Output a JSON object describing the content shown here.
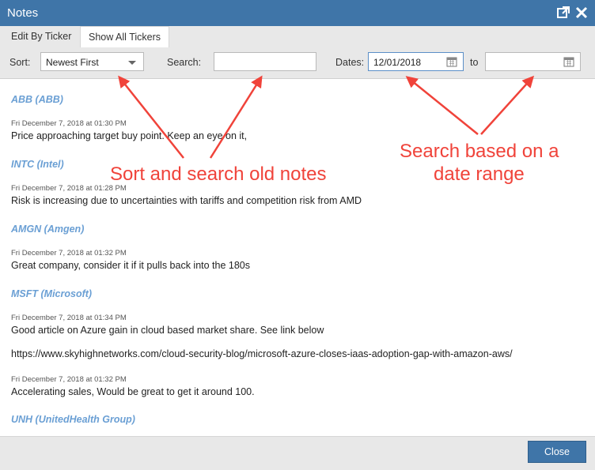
{
  "window": {
    "title": "Notes"
  },
  "tabs": [
    {
      "label": "Edit By Ticker"
    },
    {
      "label": "Show All Tickers"
    }
  ],
  "filters": {
    "sort_label": "Sort:",
    "sort_value": "Newest First",
    "search_label": "Search:",
    "search_value": "",
    "dates_label": "Dates:",
    "date_from": "12/01/2018",
    "to_label": "to",
    "date_to": ""
  },
  "notes": [
    {
      "ticker": "ABB (ABB)",
      "timestamp": "Fri December 7, 2018 at 01:30 PM",
      "text": "Price approaching target buy point. Keep an eye on it,"
    },
    {
      "ticker": "INTC (Intel)",
      "timestamp": "Fri December 7, 2018 at 01:28 PM",
      "text": "Risk is increasing due to uncertainties with tariffs and competition risk from AMD"
    },
    {
      "ticker": "AMGN (Amgen)",
      "timestamp": "Fri December 7, 2018 at 01:32 PM",
      "text": "Great company, consider it if it pulls back into the 180s"
    },
    {
      "ticker": "MSFT (Microsoft)",
      "timestamp": "Fri December 7, 2018 at 01:34 PM",
      "text": "Good article on Azure gain in cloud based market share. See link below",
      "link": "https://www.skyhighnetworks.com/cloud-security-blog/microsoft-azure-closes-iaas-adoption-gap-with-amazon-aws/"
    },
    {
      "timestamp": "Fri December 7, 2018 at 01:32 PM",
      "text": "Accelerating sales, Would be great to get it around 100."
    },
    {
      "ticker": "UNH (UnitedHealth Group)"
    }
  ],
  "annotations": {
    "left": "Sort and search old notes",
    "right_line1": "Search based on a",
    "right_line2": "date range"
  },
  "footer": {
    "close_label": "Close"
  },
  "colors": {
    "titlebar": "#3f75a8",
    "ticker": "#6a9fd4",
    "annotation": "#f0433a"
  }
}
